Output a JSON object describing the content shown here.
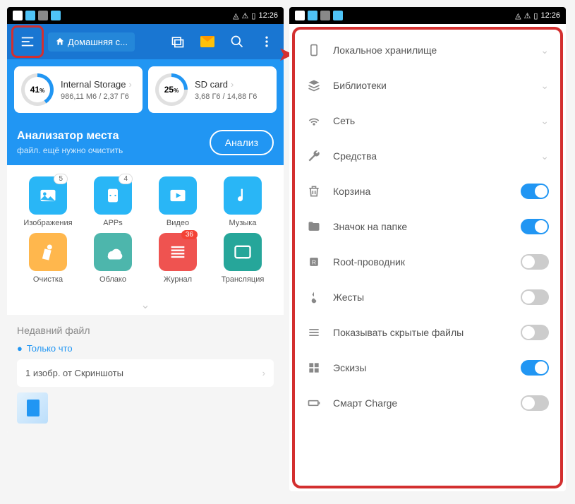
{
  "status": {
    "time": "12:26"
  },
  "topbar": {
    "home_label": "Домашняя с..."
  },
  "storage": [
    {
      "pct": "41",
      "pct_css": "41%",
      "name": "Internal Storage",
      "detail": "986,11 М6 / 2,37 Г6"
    },
    {
      "pct": "25",
      "pct_css": "25%",
      "name": "SD card",
      "detail": "3,68 Г6 / 14,88 Г6"
    }
  ],
  "analyzer": {
    "title": "Анализатор места",
    "subtitle": "файл. ещё нужно очистить",
    "button": "Анализ"
  },
  "grid": [
    {
      "label": "Изображения",
      "color": "#29b6f6",
      "badge": "5"
    },
    {
      "label": "APPs",
      "color": "#29b6f6",
      "badge": "4"
    },
    {
      "label": "Видео",
      "color": "#29b6f6"
    },
    {
      "label": "Музыка",
      "color": "#29b6f6"
    },
    {
      "label": "Очистка",
      "color": "#ffb74d"
    },
    {
      "label": "Облако",
      "color": "#4db6ac"
    },
    {
      "label": "Журнал",
      "color": "#ef5350",
      "badge": "36",
      "badge_red": true
    },
    {
      "label": "Трансляция",
      "color": "#26a69a"
    }
  ],
  "recent": {
    "header": "Недавний файл",
    "when": "Только что",
    "item": "1 изобр. от Скриншоты"
  },
  "sidebar": [
    {
      "label": "Локальное хранилище",
      "type": "chev",
      "icon": "phone"
    },
    {
      "label": "Библиотеки",
      "type": "chev",
      "icon": "stack"
    },
    {
      "label": "Сеть",
      "type": "chev",
      "icon": "wifi"
    },
    {
      "label": "Средства",
      "type": "chev",
      "icon": "wrench"
    },
    {
      "label": "Корзина",
      "type": "toggle",
      "on": true,
      "icon": "trash"
    },
    {
      "label": "Значок на папке",
      "type": "toggle",
      "on": true,
      "icon": "folder"
    },
    {
      "label": "Root-проводник",
      "type": "toggle",
      "on": false,
      "icon": "root"
    },
    {
      "label": "Жесты",
      "type": "toggle",
      "on": false,
      "icon": "gesture"
    },
    {
      "label": "Показывать скрытые файлы",
      "type": "toggle",
      "on": false,
      "icon": "lines"
    },
    {
      "label": "Эскизы",
      "type": "toggle",
      "on": true,
      "icon": "thumb"
    },
    {
      "label": "Смарт Charge",
      "type": "toggle",
      "on": false,
      "icon": "battery"
    }
  ],
  "peek": {
    "storage": "4,88 Г6",
    "analyze": "ИЗ",
    "music": "узыка",
    "cast": "нсляция"
  }
}
